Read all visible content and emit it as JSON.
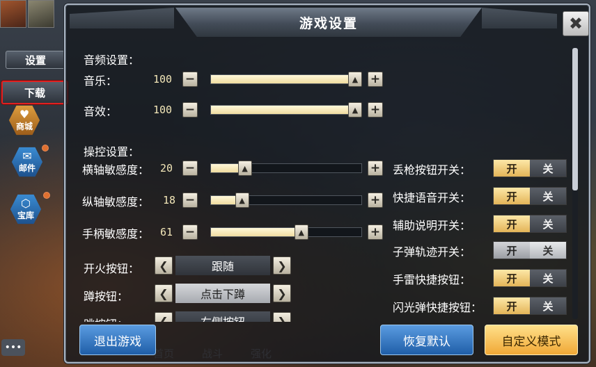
{
  "dialog": {
    "title": "游戏设置",
    "close_label": "✖"
  },
  "background": {
    "side_menu": {
      "settings": "设置",
      "download": "下载"
    },
    "hex_buttons": [
      {
        "label": "商城",
        "icon": "shop-icon"
      },
      {
        "label": "邮件",
        "icon": "mail-icon"
      },
      {
        "label": "宝库",
        "icon": "treasure-icon"
      }
    ],
    "bottom_nav": [
      "首页",
      "战斗",
      "强化"
    ],
    "chat_label": "•••"
  },
  "audio": {
    "section_title": "音频设置：",
    "music": {
      "label": "音乐：",
      "value": "100",
      "level": 1.0
    },
    "sfx": {
      "label": "音效：",
      "value": "100",
      "level": 1.0
    }
  },
  "controls": {
    "section_title": "操控设置：",
    "h_sens": {
      "label": "横轴敏感度：",
      "value": "20",
      "level": 0.2
    },
    "v_sens": {
      "label": "纵轴敏感度：",
      "value": "18",
      "level": 0.18
    },
    "gamepad_sens": {
      "label": "手柄敏感度：",
      "value": "61",
      "level": 0.61
    },
    "fire_button": {
      "label": "开火按钮：",
      "value": "跟随"
    },
    "crouch_button": {
      "label": "蹲按钮：",
      "value": "点击下蹲"
    },
    "jump_button": {
      "label": "跳按钮：",
      "value": "右侧按钮"
    }
  },
  "toggles": [
    {
      "label": "丢枪按钮开关：",
      "on": "开",
      "off": "关",
      "state": "on"
    },
    {
      "label": "快捷语音开关：",
      "on": "开",
      "off": "关",
      "state": "on"
    },
    {
      "label": "辅助说明开关：",
      "on": "开",
      "off": "关",
      "state": "on"
    },
    {
      "label": "子弹轨迹开关：",
      "on": "开",
      "off": "关",
      "state": "off"
    },
    {
      "label": "手雷快捷按钮：",
      "on": "开",
      "off": "关",
      "state": "on"
    },
    {
      "label": "闪光弹快捷按钮：",
      "on": "开",
      "off": "关",
      "state": "on"
    }
  ],
  "footer": {
    "exit": "退出游戏",
    "reset": "恢复默认",
    "custom": "自定义模式"
  },
  "symbols": {
    "minus": "−",
    "plus": "+",
    "left": "❮",
    "right": "❯",
    "thumb": "▲"
  }
}
